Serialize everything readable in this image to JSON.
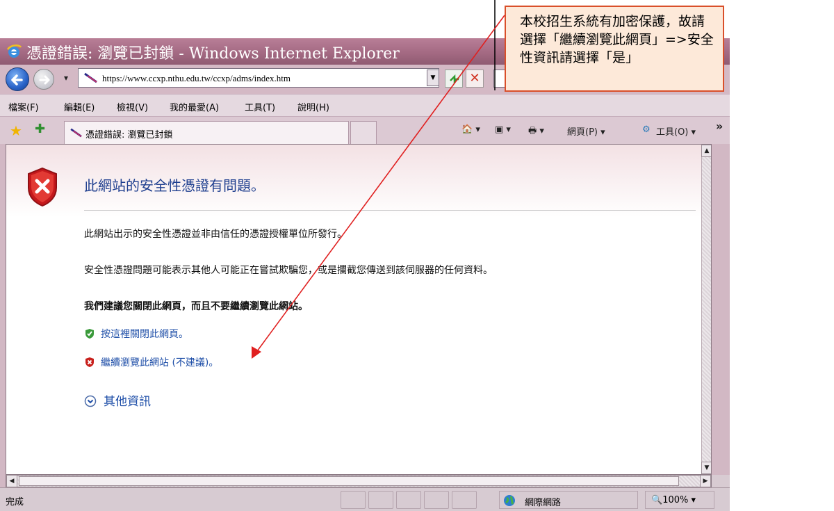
{
  "window": {
    "title": "憑證錯誤: 瀏覽已封鎖 - Windows Internet Explorer"
  },
  "address_bar": {
    "url": "https://www.ccxp.nthu.edu.tw/ccxp/adms/index.htm",
    "nav_dropdown": "▾",
    "url_dropdown": "▼",
    "stop_glyph": "✕"
  },
  "menu": {
    "items": [
      "檔案(F)",
      "編輯(E)",
      "檢視(V)",
      "我的最愛(A)",
      "工具(T)",
      "說明(H)"
    ]
  },
  "tab": {
    "label": "憑證錯誤: 瀏覽已封鎖"
  },
  "command_bar": {
    "home": "🏠 ▾",
    "feeds": "▣ ▾",
    "print": "🖶 ▾",
    "page": "網頁(P) ▾",
    "tools": "工具(O) ▾",
    "more": "»"
  },
  "error_page": {
    "title": "此網站的安全性憑證有問題。",
    "line1": "此網站出示的安全性憑證並非由信任的憑證授權單位所發行。",
    "line2": "安全性憑證問題可能表示其他人可能正在嘗試欺騙您，或是攔截您傳送到該伺服器的任何資料。",
    "line3": "我們建議您關閉此網頁，而且不要繼續瀏覽此網站。",
    "close_link": "按這裡關閉此網頁。",
    "continue_link": "繼續瀏覽此網站 (不建議)。",
    "more_info": "其他資訊"
  },
  "status_bar": {
    "status": "完成",
    "zone": "網際網路",
    "zoom": "100%  ▾"
  },
  "annotation": {
    "text": "本校招生系統有加密保護，故請選擇「繼續瀏覽此網頁」=>安全性資訊請選擇「是」",
    "color": "#e02020"
  },
  "colors": {
    "title_bar": "#a46a83",
    "chrome": "#d4b9c5",
    "link_blue": "#1f4fa8",
    "heading_blue": "#1f3f8f",
    "callout_fill": "#fde9d9",
    "callout_border": "#d94f2a"
  }
}
